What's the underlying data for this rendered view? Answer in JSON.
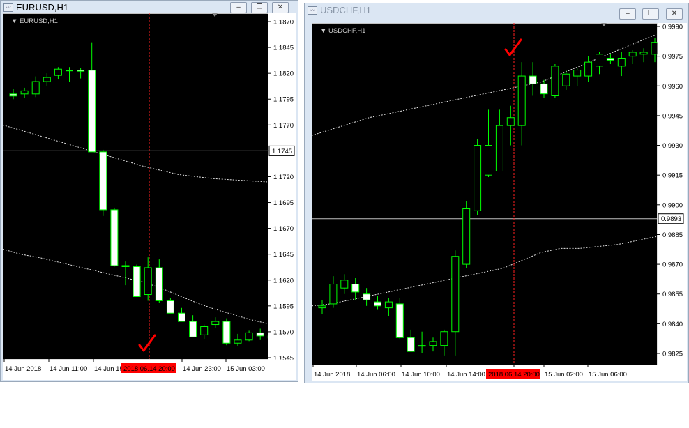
{
  "windows": [
    {
      "title": "EURUSD,H1",
      "chart_label": "EURUSD,H1",
      "price_ticks": [
        "1.1870",
        "1.1845",
        "1.1820",
        "1.1795",
        "1.1770",
        "1.1745",
        "1.1720",
        "1.1695",
        "1.1670",
        "1.1645",
        "1.1620",
        "1.1595",
        "1.1570",
        "1.1545"
      ],
      "time_labels": [
        "14 Jun 2018",
        "14 Jun 11:00",
        "14 Jun 15",
        "14 Jun 23:00",
        "15 Jun 03:00"
      ],
      "crosshair_time": "2018.06.14 20:00",
      "crosshair_price": "1.1745"
    },
    {
      "title": "USDCHF,H1",
      "chart_label": "USDCHF,H1",
      "price_ticks": [
        "0.9990",
        "0.9975",
        "0.9960",
        "0.9945",
        "0.9930",
        "0.9915",
        "0.9900",
        "0.9885",
        "0.9870",
        "0.9855",
        "0.9840",
        "0.9825"
      ],
      "time_labels": [
        "14 Jun 2018",
        "14 Jun 06:00",
        "14 Jun 10:00",
        "14 Jun 14:00",
        "22:00",
        "15 Jun 02:00",
        "15 Jun 06:00"
      ],
      "crosshair_time": "2018.06.14 20:00",
      "crosshair_price": "0.9893"
    }
  ],
  "colors": {
    "chart_bg": "#000000",
    "bull_candle_fill": "#ffffff",
    "candle_outline": "#00ff00",
    "crosshair_vertical": "#ff2020",
    "crosshair_horizontal": "#c0c0c0",
    "checkmark": "#ff0000",
    "time_highlight_bg": "#ff0000"
  },
  "icons": {
    "window_icon": "chart-window-icon",
    "minimize": "minimize-icon",
    "restore": "restore-icon",
    "close": "close-icon",
    "checkmark": "checkmark-icon",
    "chart_menu": "triangle-down-icon"
  },
  "chart_data": [
    {
      "type": "candlestick",
      "symbol": "EURUSD",
      "timeframe": "H1",
      "ylim": [
        1.154,
        1.188
      ],
      "candles": [
        [
          1.18,
          1.1805,
          1.1795,
          1.1798
        ],
        [
          1.18,
          1.1806,
          1.1796,
          1.1803
        ],
        [
          1.18,
          1.1817,
          1.1797,
          1.1812
        ],
        [
          1.1812,
          1.182,
          1.1808,
          1.1816
        ],
        [
          1.1818,
          1.1826,
          1.1814,
          1.1824
        ],
        [
          1.1823,
          1.1826,
          1.1812,
          1.1823
        ],
        [
          1.1823,
          1.1825,
          1.1815,
          1.1822
        ],
        [
          1.1823,
          1.185,
          1.1813,
          1.1744
        ],
        [
          1.1744,
          1.1746,
          1.1682,
          1.1688
        ],
        [
          1.1688,
          1.169,
          1.1633,
          1.1634
        ],
        [
          1.1634,
          1.1638,
          1.1615,
          1.1633
        ],
        [
          1.1633,
          1.1635,
          1.1605,
          1.1604
        ],
        [
          1.1606,
          1.1642,
          1.16,
          1.1632
        ],
        [
          1.1632,
          1.164,
          1.1598,
          1.16
        ],
        [
          1.16,
          1.1603,
          1.1588,
          1.1588
        ],
        [
          1.1588,
          1.1593,
          1.1583,
          1.158
        ],
        [
          1.158,
          1.1586,
          1.1567,
          1.1565
        ],
        [
          1.1567,
          1.1577,
          1.1563,
          1.1575
        ],
        [
          1.1577,
          1.1584,
          1.1574,
          1.158
        ],
        [
          1.158,
          1.1583,
          1.1557,
          1.1559
        ],
        [
          1.1559,
          1.1568,
          1.1556,
          1.1562
        ],
        [
          1.1562,
          1.1571,
          1.1561,
          1.1569
        ],
        [
          1.1569,
          1.1573,
          1.1562,
          1.1566
        ],
        [
          1.1566,
          1.157,
          1.1561,
          1.1564
        ]
      ],
      "band_upper": [
        1.177,
        1.1765,
        1.176,
        1.1755,
        1.175,
        1.1745,
        1.174,
        1.1735,
        1.173,
        1.1726,
        1.1722,
        1.172,
        1.1718,
        1.1717,
        1.1716,
        1.1715
      ],
      "band_lower": [
        1.165,
        1.1645,
        1.1642,
        1.1638,
        1.1634,
        1.163,
        1.1626,
        1.1622,
        1.1618,
        1.1612,
        1.1605,
        1.1598,
        1.1592,
        1.1587,
        1.1582,
        1.1578
      ],
      "crosshair_price": 1.1745,
      "crosshair_time": "2018.06.14 20:00"
    },
    {
      "type": "candlestick",
      "symbol": "USDCHF",
      "timeframe": "H1",
      "ylim": [
        0.982,
        0.9995
      ],
      "candles": [
        [
          0.9848,
          0.9852,
          0.9845,
          0.9849
        ],
        [
          0.985,
          0.9864,
          0.9848,
          0.986
        ],
        [
          0.9858,
          0.9865,
          0.9855,
          0.9862
        ],
        [
          0.986,
          0.9863,
          0.9852,
          0.9856
        ],
        [
          0.9855,
          0.9858,
          0.9849,
          0.9852
        ],
        [
          0.9851,
          0.9854,
          0.9847,
          0.9849
        ],
        [
          0.9848,
          0.9853,
          0.9844,
          0.9851
        ],
        [
          0.985,
          0.9853,
          0.9832,
          0.9833
        ],
        [
          0.9833,
          0.9837,
          0.9826,
          0.9826
        ],
        [
          0.9829,
          0.9836,
          0.9825,
          0.9829
        ],
        [
          0.9829,
          0.9833,
          0.9826,
          0.9831
        ],
        [
          0.9829,
          0.9837,
          0.9824,
          0.9836
        ],
        [
          0.9836,
          0.9877,
          0.9824,
          0.9874
        ],
        [
          0.987,
          0.9902,
          0.9868,
          0.9898
        ],
        [
          0.9897,
          0.9933,
          0.9895,
          0.993
        ],
        [
          0.9915,
          0.9948,
          0.9914,
          0.993
        ],
        [
          0.9917,
          0.9948,
          0.9917,
          0.994
        ],
        [
          0.994,
          0.995,
          0.993,
          0.9944
        ],
        [
          0.994,
          0.9972,
          0.993,
          0.9965
        ],
        [
          0.9965,
          0.9972,
          0.9955,
          0.9961
        ],
        [
          0.9961,
          0.9963,
          0.9954,
          0.9956
        ],
        [
          0.9955,
          0.9971,
          0.9954,
          0.997
        ],
        [
          0.996,
          0.9968,
          0.9958,
          0.9966
        ],
        [
          0.9965,
          0.9969,
          0.996,
          0.9968
        ],
        [
          0.9965,
          0.9975,
          0.9962,
          0.9972
        ],
        [
          0.997,
          0.9977,
          0.9966,
          0.9976
        ],
        [
          0.9974,
          0.9976,
          0.9971,
          0.9973
        ],
        [
          0.997,
          0.9977,
          0.9965,
          0.9974
        ],
        [
          0.9975,
          0.9978,
          0.9971,
          0.9977
        ],
        [
          0.9976,
          0.9979,
          0.9972,
          0.9977
        ],
        [
          0.9976,
          0.9984,
          0.9972,
          0.9982
        ]
      ],
      "band_upper": [
        0.9935,
        0.9938,
        0.9941,
        0.9944,
        0.9946,
        0.9948,
        0.995,
        0.9952,
        0.9954,
        0.9956,
        0.9958,
        0.996,
        0.9962,
        0.9966,
        0.997,
        0.9974,
        0.9978,
        0.9982,
        0.9986
      ],
      "band_lower": [
        0.9849,
        0.985,
        0.9852,
        0.9854,
        0.9856,
        0.9858,
        0.986,
        0.9862,
        0.9864,
        0.9866,
        0.9868,
        0.9872,
        0.9876,
        0.9878,
        0.9878,
        0.9879,
        0.988,
        0.9882,
        0.9884
      ],
      "crosshair_price": 0.9893,
      "crosshair_time": "2018.06.14 20:00"
    }
  ]
}
